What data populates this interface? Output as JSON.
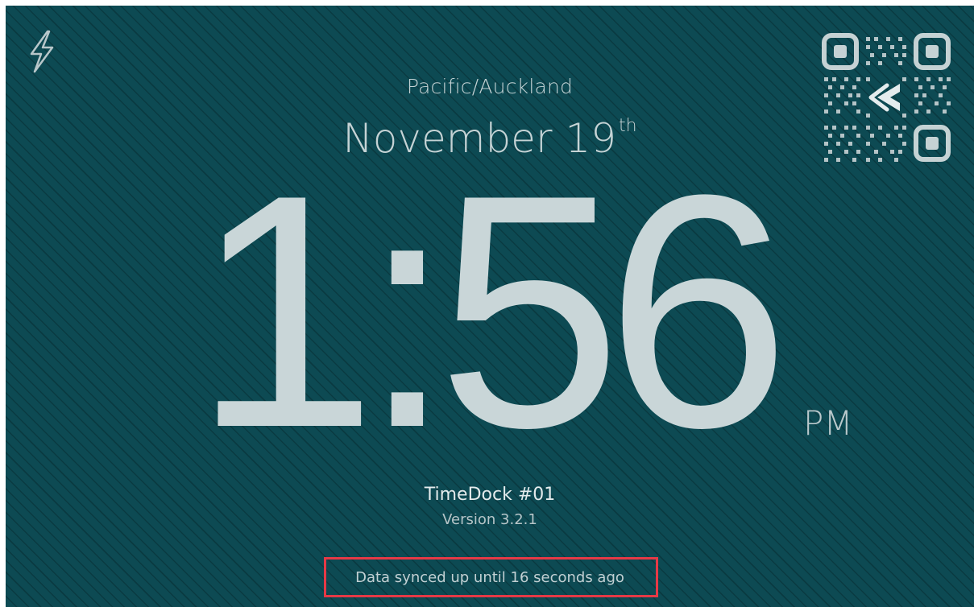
{
  "timezone": "Pacific/Auckland",
  "date": {
    "month_day": "November 19",
    "suffix": "th"
  },
  "time": {
    "value": "1:56",
    "meridiem": "PM"
  },
  "device": {
    "name": "TimeDock #01",
    "version": "Version 3.2.1"
  },
  "sync_status": "Data synced up until 16 seconds ago",
  "icons": {
    "status": "lightning-bolt-icon",
    "qr": "qr-code-icon"
  },
  "colors": {
    "background": "#0d4a53",
    "text": "#c9d6d8",
    "highlight_border": "#e63946"
  }
}
